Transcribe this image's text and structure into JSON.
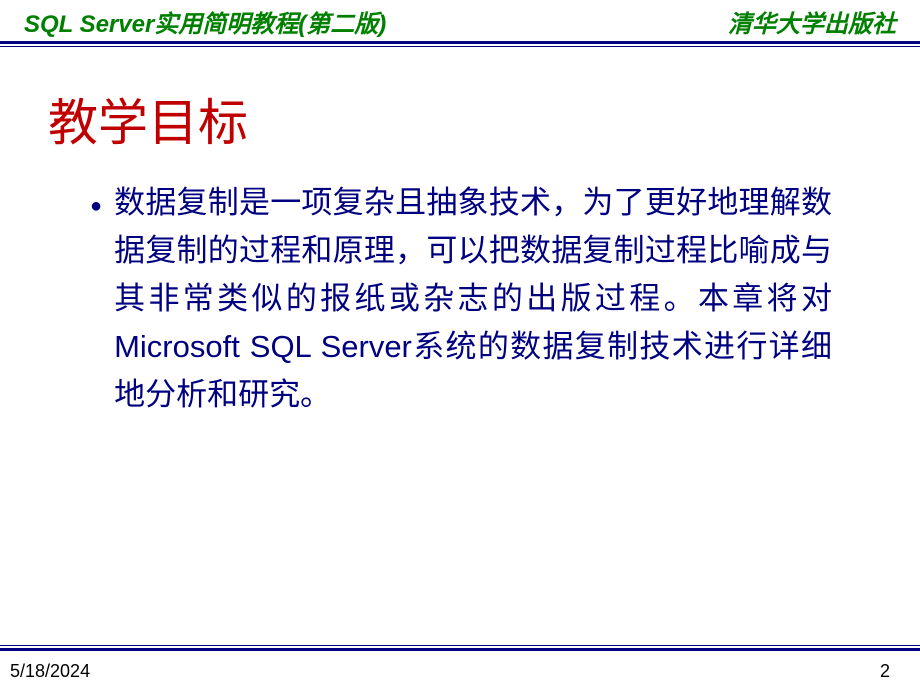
{
  "header": {
    "left": "SQL Server实用简明教程(第二版)",
    "right": "清华大学出版社"
  },
  "title": "教学目标",
  "content": {
    "bullet_marker": "●",
    "body_text": "数据复制是一项复杂且抽象技术，为了更好地理解数据复制的过程和原理，可以把数据复制过程比喻成与其非常类似的报纸或杂志的出版过程。本章将对Microsoft SQL Server系统的数据复制技术进行详细地分析和研究。"
  },
  "footer": {
    "date": "5/18/2024",
    "page_number": "2"
  }
}
